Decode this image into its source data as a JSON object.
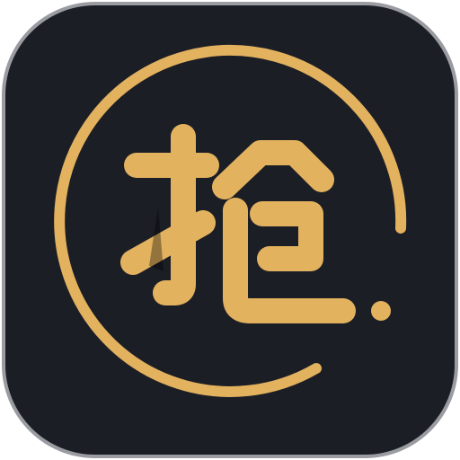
{
  "icon": {
    "glyph": "抢",
    "colors": {
      "tile_background": "#1c1e26",
      "tile_border": "#9a9ca2",
      "accent_gold": "#e3b25f"
    }
  }
}
